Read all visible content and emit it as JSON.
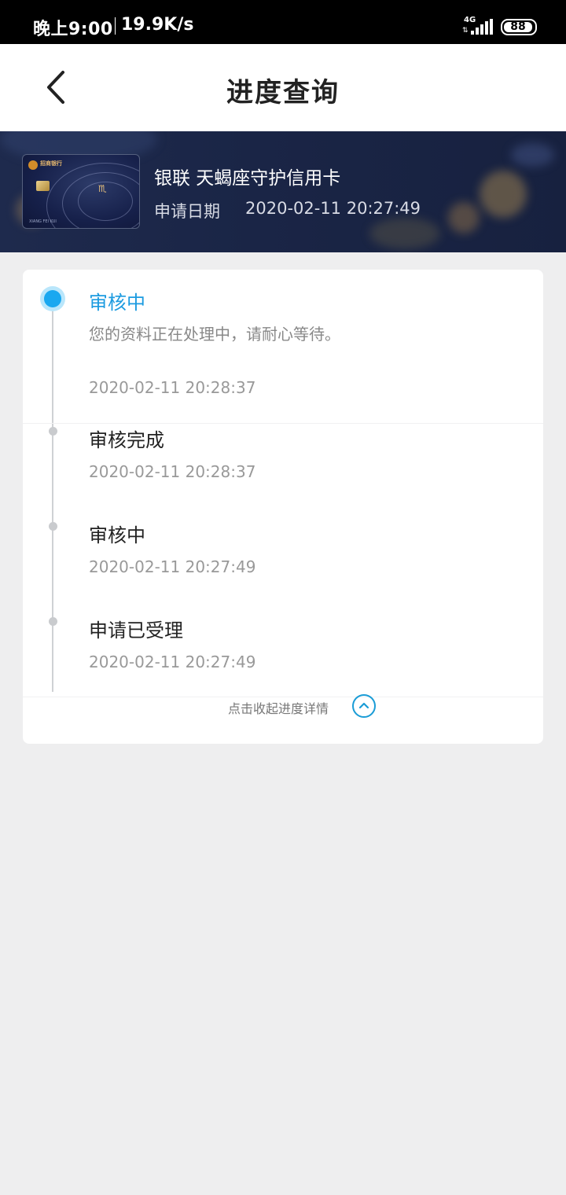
{
  "status_bar": {
    "time": "晚上9:00",
    "speed": "19.9K/s",
    "network": "4G",
    "battery": "88"
  },
  "header": {
    "title": "进度查询"
  },
  "card": {
    "bank_name": "招商银行",
    "name": "银联 天蝎座守护信用卡",
    "holder": "XIANG FEI KUI",
    "date_label": "申请日期",
    "date_value": "2020-02-11 20:27:49"
  },
  "timeline": [
    {
      "title": "审核中",
      "desc": "您的资料正在处理中，请耐心等待。",
      "time": "2020-02-11 20:28:37",
      "active": true
    },
    {
      "title": "审核完成",
      "time": "2020-02-11 20:28:37",
      "active": false
    },
    {
      "title": "审核中",
      "time": "2020-02-11 20:27:49",
      "active": false
    },
    {
      "title": "申请已受理",
      "time": "2020-02-11 20:27:49",
      "active": false
    }
  ],
  "collapse": {
    "label": "点击收起进度详情"
  },
  "colors": {
    "accent": "#1c9be0",
    "active_dot": "#1aa8f0",
    "banner_bg": "#1e2a4d"
  }
}
